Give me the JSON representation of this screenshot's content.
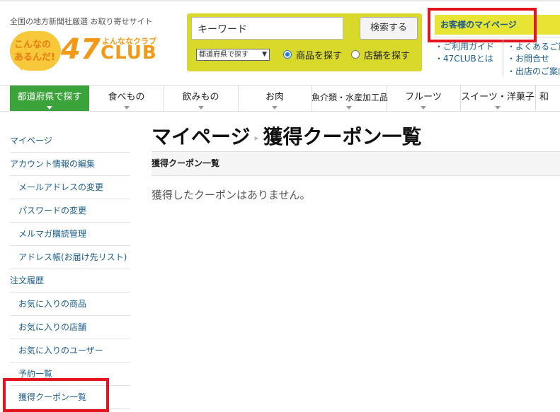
{
  "header": {
    "tagline": "全国の地方新聞社厳選 お取り寄せサイト",
    "logo": {
      "bubble_line1": "こんなの",
      "bubble_line2": "あるんだ!",
      "number": "47",
      "small_text": "よんななクラブ",
      "club_text": "CLUB"
    }
  },
  "search": {
    "keyword_value": "キーワード",
    "button_label": "検索する",
    "prefecture_select": "都道府県で探す",
    "radio_products": "商品を探す",
    "radio_stores": "店舗を探す",
    "selected": "products"
  },
  "account": {
    "mypage_label": "お客様のマイページ",
    "links_left": [
      "・ご利用ガイド",
      "・47CLUBとは"
    ],
    "links_right": [
      "・よくあるご質問",
      "・お問合せ",
      "・出店のご案内"
    ]
  },
  "nav": {
    "items": [
      {
        "label": "都道府県で探す",
        "active": true
      },
      {
        "label": "食べもの",
        "active": false
      },
      {
        "label": "飲みもの",
        "active": false
      },
      {
        "label": "お肉",
        "active": false
      },
      {
        "label": "魚介類・水産加工品",
        "active": false
      },
      {
        "label": "フルーツ",
        "active": false
      },
      {
        "label": "スイーツ・洋菓子",
        "active": false
      },
      {
        "label": "和",
        "active": false
      }
    ]
  },
  "sidebar": {
    "items": [
      {
        "label": "マイページ",
        "sub": false
      },
      {
        "label": "アカウント情報の編集",
        "sub": false
      },
      {
        "label": "メールアドレスの変更",
        "sub": true
      },
      {
        "label": "パスワードの変更",
        "sub": true
      },
      {
        "label": "メルマガ購読管理",
        "sub": true
      },
      {
        "label": "アドレス帳(お届け先リスト)",
        "sub": true
      },
      {
        "label": "注文履歴",
        "sub": false
      },
      {
        "label": "お気に入りの商品",
        "sub": true
      },
      {
        "label": "お気に入りの店舗",
        "sub": true
      },
      {
        "label": "お気に入りのユーザー",
        "sub": true
      },
      {
        "label": "予約一覧",
        "sub": true
      },
      {
        "label": "獲得クーポン一覧",
        "sub": true
      }
    ]
  },
  "main": {
    "title_parent": "マイページ",
    "title_separator": "▸",
    "title_current": "獲得クーポン一覧",
    "breadcrumb": "獲得クーポン一覧",
    "empty_message": "獲得したクーポンはありません。"
  },
  "colors": {
    "nav_active": "#3aa33a",
    "search_bg": "#d8d92a",
    "mypage_bg": "#e8e433",
    "link": "#1a5c8c",
    "highlight_box": "#e4141e"
  }
}
